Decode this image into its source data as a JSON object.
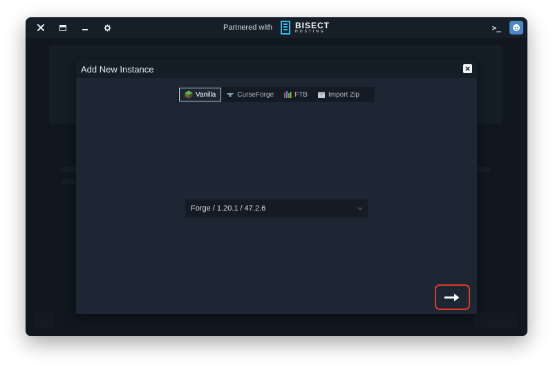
{
  "titlebar": {
    "partnered_text": "Partnered with",
    "partner_name": "BISECT",
    "partner_sub": "HOSTING",
    "icons": [
      "close-icon",
      "window-icon",
      "minimize-icon",
      "gear-icon",
      "terminal-icon",
      "avatar"
    ]
  },
  "modal": {
    "title": "Add New Instance",
    "tabs": [
      {
        "label": "Vanilla",
        "icon": "grass-block-icon",
        "active": true
      },
      {
        "label": "CurseForge",
        "icon": "curseforge-icon",
        "active": false
      },
      {
        "label": "FTB",
        "icon": "ftb-icon",
        "active": false
      },
      {
        "label": "Import Zip",
        "icon": "zip-icon",
        "active": false
      }
    ],
    "version_select": {
      "value": "Forge / 1.20.1 / 47.2.6"
    },
    "next_icon": "arrow-right-icon"
  },
  "colors": {
    "accent_highlight": "#e23b22",
    "window_bg": "#1b2430",
    "modal_bg": "#1d2733",
    "header_bg": "#151d27"
  }
}
